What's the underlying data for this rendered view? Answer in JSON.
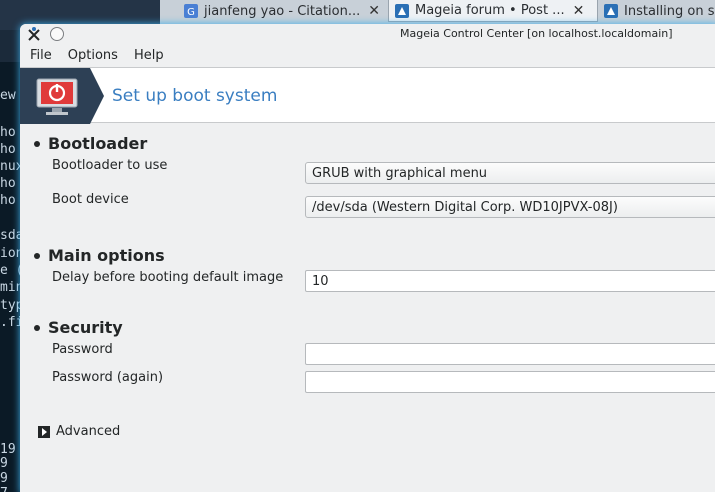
{
  "browser_tabs": [
    {
      "title": "jianfeng yao - Citation...",
      "close": "✕"
    },
    {
      "title": "Mageia forum • Post ...",
      "close": "✕"
    },
    {
      "title": "Installing on sy"
    }
  ],
  "terminal_fragments": [
    "ew",
    "ho",
    "ho",
    "nux",
    "ho",
    "ho",
    "sda",
    "ion",
    "e (",
    "min",
    "typ",
    ".fi",
    "19",
    "9",
    "9",
    "7"
  ],
  "window": {
    "title": "Mageia Control Center  [on localhost.localdomain]"
  },
  "menu": [
    "File",
    "Options",
    "Help"
  ],
  "header": {
    "title": "Set up boot system"
  },
  "sections": {
    "bootloader": {
      "heading": "Bootloader",
      "bootloader_label": "Bootloader to use",
      "bootloader_value": "GRUB with graphical menu",
      "device_label": "Boot device",
      "device_value": "/dev/sda (Western Digital Corp. WD10JPVX-08J)"
    },
    "main_options": {
      "heading": "Main options",
      "delay_label": "Delay before booting default image",
      "delay_value": "10"
    },
    "security": {
      "heading": "Security",
      "password_label": "Password",
      "password_value": "",
      "password_again_label": "Password (again)",
      "password_again_value": ""
    }
  },
  "advanced": {
    "label": "Advanced"
  },
  "icons": {
    "window_app": "mageia-x-icon",
    "window_button": "circle-button-icon",
    "header": "power-monitor-icon",
    "expander": "triangle-right-icon"
  }
}
